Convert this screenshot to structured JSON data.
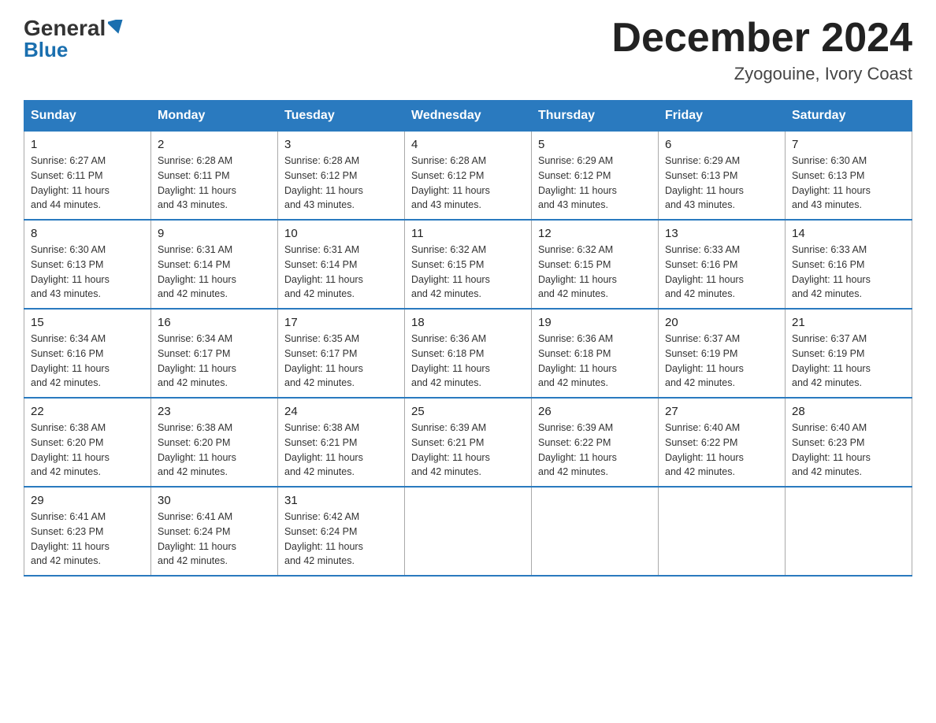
{
  "logo": {
    "general": "General",
    "blue": "Blue",
    "line2": "Blue"
  },
  "title": "December 2024",
  "location": "Zyogouine, Ivory Coast",
  "days_of_week": [
    "Sunday",
    "Monday",
    "Tuesday",
    "Wednesday",
    "Thursday",
    "Friday",
    "Saturday"
  ],
  "weeks": [
    [
      {
        "day": "1",
        "info": "Sunrise: 6:27 AM\nSunset: 6:11 PM\nDaylight: 11 hours\nand 44 minutes."
      },
      {
        "day": "2",
        "info": "Sunrise: 6:28 AM\nSunset: 6:11 PM\nDaylight: 11 hours\nand 43 minutes."
      },
      {
        "day": "3",
        "info": "Sunrise: 6:28 AM\nSunset: 6:12 PM\nDaylight: 11 hours\nand 43 minutes."
      },
      {
        "day": "4",
        "info": "Sunrise: 6:28 AM\nSunset: 6:12 PM\nDaylight: 11 hours\nand 43 minutes."
      },
      {
        "day": "5",
        "info": "Sunrise: 6:29 AM\nSunset: 6:12 PM\nDaylight: 11 hours\nand 43 minutes."
      },
      {
        "day": "6",
        "info": "Sunrise: 6:29 AM\nSunset: 6:13 PM\nDaylight: 11 hours\nand 43 minutes."
      },
      {
        "day": "7",
        "info": "Sunrise: 6:30 AM\nSunset: 6:13 PM\nDaylight: 11 hours\nand 43 minutes."
      }
    ],
    [
      {
        "day": "8",
        "info": "Sunrise: 6:30 AM\nSunset: 6:13 PM\nDaylight: 11 hours\nand 43 minutes."
      },
      {
        "day": "9",
        "info": "Sunrise: 6:31 AM\nSunset: 6:14 PM\nDaylight: 11 hours\nand 42 minutes."
      },
      {
        "day": "10",
        "info": "Sunrise: 6:31 AM\nSunset: 6:14 PM\nDaylight: 11 hours\nand 42 minutes."
      },
      {
        "day": "11",
        "info": "Sunrise: 6:32 AM\nSunset: 6:15 PM\nDaylight: 11 hours\nand 42 minutes."
      },
      {
        "day": "12",
        "info": "Sunrise: 6:32 AM\nSunset: 6:15 PM\nDaylight: 11 hours\nand 42 minutes."
      },
      {
        "day": "13",
        "info": "Sunrise: 6:33 AM\nSunset: 6:16 PM\nDaylight: 11 hours\nand 42 minutes."
      },
      {
        "day": "14",
        "info": "Sunrise: 6:33 AM\nSunset: 6:16 PM\nDaylight: 11 hours\nand 42 minutes."
      }
    ],
    [
      {
        "day": "15",
        "info": "Sunrise: 6:34 AM\nSunset: 6:16 PM\nDaylight: 11 hours\nand 42 minutes."
      },
      {
        "day": "16",
        "info": "Sunrise: 6:34 AM\nSunset: 6:17 PM\nDaylight: 11 hours\nand 42 minutes."
      },
      {
        "day": "17",
        "info": "Sunrise: 6:35 AM\nSunset: 6:17 PM\nDaylight: 11 hours\nand 42 minutes."
      },
      {
        "day": "18",
        "info": "Sunrise: 6:36 AM\nSunset: 6:18 PM\nDaylight: 11 hours\nand 42 minutes."
      },
      {
        "day": "19",
        "info": "Sunrise: 6:36 AM\nSunset: 6:18 PM\nDaylight: 11 hours\nand 42 minutes."
      },
      {
        "day": "20",
        "info": "Sunrise: 6:37 AM\nSunset: 6:19 PM\nDaylight: 11 hours\nand 42 minutes."
      },
      {
        "day": "21",
        "info": "Sunrise: 6:37 AM\nSunset: 6:19 PM\nDaylight: 11 hours\nand 42 minutes."
      }
    ],
    [
      {
        "day": "22",
        "info": "Sunrise: 6:38 AM\nSunset: 6:20 PM\nDaylight: 11 hours\nand 42 minutes."
      },
      {
        "day": "23",
        "info": "Sunrise: 6:38 AM\nSunset: 6:20 PM\nDaylight: 11 hours\nand 42 minutes."
      },
      {
        "day": "24",
        "info": "Sunrise: 6:38 AM\nSunset: 6:21 PM\nDaylight: 11 hours\nand 42 minutes."
      },
      {
        "day": "25",
        "info": "Sunrise: 6:39 AM\nSunset: 6:21 PM\nDaylight: 11 hours\nand 42 minutes."
      },
      {
        "day": "26",
        "info": "Sunrise: 6:39 AM\nSunset: 6:22 PM\nDaylight: 11 hours\nand 42 minutes."
      },
      {
        "day": "27",
        "info": "Sunrise: 6:40 AM\nSunset: 6:22 PM\nDaylight: 11 hours\nand 42 minutes."
      },
      {
        "day": "28",
        "info": "Sunrise: 6:40 AM\nSunset: 6:23 PM\nDaylight: 11 hours\nand 42 minutes."
      }
    ],
    [
      {
        "day": "29",
        "info": "Sunrise: 6:41 AM\nSunset: 6:23 PM\nDaylight: 11 hours\nand 42 minutes."
      },
      {
        "day": "30",
        "info": "Sunrise: 6:41 AM\nSunset: 6:24 PM\nDaylight: 11 hours\nand 42 minutes."
      },
      {
        "day": "31",
        "info": "Sunrise: 6:42 AM\nSunset: 6:24 PM\nDaylight: 11 hours\nand 42 minutes."
      },
      null,
      null,
      null,
      null
    ]
  ]
}
